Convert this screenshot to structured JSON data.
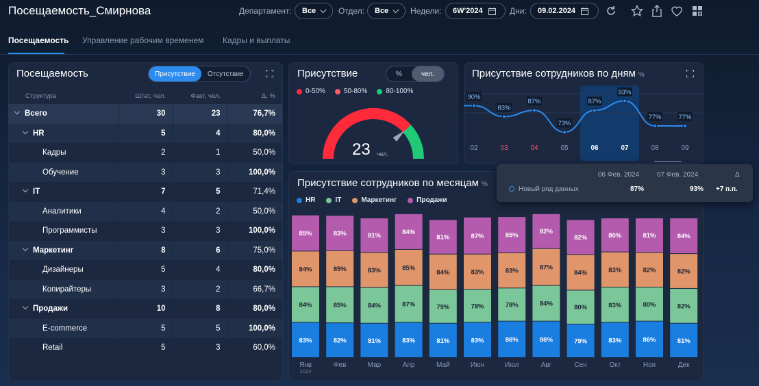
{
  "header": {
    "title": "Посещаемость_Смирнова",
    "filters": {
      "department_label": "Департамент:",
      "department_value": "Все",
      "division_label": "Отдел:",
      "division_value": "Все",
      "weeks_label": "Недели:",
      "weeks_value": "6W'2024",
      "days_label": "Дни:",
      "days_value": "09.02.2024"
    },
    "icons": [
      "refresh-icon",
      "star-icon",
      "share-icon",
      "heart-icon",
      "grid-icon"
    ]
  },
  "tabs": [
    {
      "label": "Посещаемость",
      "active": true
    },
    {
      "label": "Управление рабочим временем",
      "active": false
    },
    {
      "label": "Кадры и выплаты",
      "active": false
    }
  ],
  "attendance_table": {
    "title": "Посещаемость",
    "toggle": {
      "on": "Присутствие",
      "off": "Отсутствие"
    },
    "columns": [
      "Структура",
      "Штат, чел.",
      "Факт, чел.",
      "Δ, %"
    ],
    "rows": [
      {
        "name": "Всего",
        "level": 0,
        "staff": "30",
        "fact": "23",
        "delta": "76,7%",
        "status": "neg"
      },
      {
        "name": "HR",
        "level": 1,
        "staff": "5",
        "fact": "4",
        "delta": "80,0%",
        "status": "pos"
      },
      {
        "name": "Кадры",
        "level": 2,
        "staff": "2",
        "fact": "1",
        "delta": "50,0%",
        "status": "neg"
      },
      {
        "name": "Обучение",
        "level": 2,
        "staff": "3",
        "fact": "3",
        "delta": "100,0%",
        "status": "pos"
      },
      {
        "name": "IT",
        "level": 1,
        "staff": "7",
        "fact": "5",
        "delta": "71,4%",
        "status": "neg"
      },
      {
        "name": "Аналитики",
        "level": 2,
        "staff": "4",
        "fact": "2",
        "delta": "50,0%",
        "status": "neg"
      },
      {
        "name": "Программисты",
        "level": 2,
        "staff": "3",
        "fact": "3",
        "delta": "100,0%",
        "status": "pos"
      },
      {
        "name": "Маркетинг",
        "level": 1,
        "staff": "8",
        "fact": "6",
        "delta": "75,0%",
        "status": "neg"
      },
      {
        "name": "Дизайнеры",
        "level": 2,
        "staff": "5",
        "fact": "4",
        "delta": "80,0%",
        "status": "pos"
      },
      {
        "name": "Копирайтеры",
        "level": 2,
        "staff": "3",
        "fact": "2",
        "delta": "66,7%",
        "status": "neg"
      },
      {
        "name": "Продажи",
        "level": 1,
        "staff": "10",
        "fact": "8",
        "delta": "80,0%",
        "status": "pos"
      },
      {
        "name": "E-commerce",
        "level": 2,
        "staff": "5",
        "fact": "5",
        "delta": "100,0%",
        "status": "pos"
      },
      {
        "name": "Retail",
        "level": 2,
        "staff": "5",
        "fact": "3",
        "delta": "60,0%",
        "status": "neg"
      }
    ]
  },
  "presence_gauge": {
    "title": "Присутствие",
    "toggle": {
      "pct": "%",
      "people": "чел."
    },
    "legend": [
      {
        "label": "0-50%",
        "color": "#ff2a3a"
      },
      {
        "label": "50-80%",
        "color": "#ff5a66"
      },
      {
        "label": "80-100%",
        "color": "#1fc978"
      }
    ],
    "value": "23",
    "unit": "чел.",
    "value_fraction": 0.767
  },
  "chart_data": [
    {
      "type": "line",
      "title": "Присутствие сотрудников по дням",
      "unit": "%",
      "categories": [
        "02",
        "03",
        "04",
        "05",
        "06",
        "07",
        "08",
        "09"
      ],
      "values": [
        90,
        83,
        87,
        73,
        87,
        93,
        77,
        77
      ],
      "weekend": [
        "03",
        "04"
      ],
      "highlight": [
        "06",
        "07"
      ],
      "tooltip": {
        "col1": "06 Фев. 2024",
        "col2": "07 Фев. 2024",
        "col3": "Δ",
        "series": "Новый ряд данных",
        "v1": "87%",
        "v2": "93%",
        "delta": "+7 п.п."
      }
    },
    {
      "type": "bar",
      "stacked": true,
      "title": "Присутствие сотрудников по месяцам",
      "unit": "%",
      "categories": [
        "Янв",
        "Фев",
        "Мар",
        "Апр",
        "Май",
        "Июн",
        "Июл",
        "Авг",
        "Сен",
        "Окт",
        "Ноя",
        "Дек"
      ],
      "year_label": "2024",
      "series": [
        {
          "name": "HR",
          "color": "#1a7de0",
          "values": [
            83,
            82,
            81,
            83,
            81,
            83,
            86,
            86,
            79,
            83,
            86,
            81
          ]
        },
        {
          "name": "IT",
          "color": "#7cc79a",
          "values": [
            84,
            85,
            84,
            87,
            79,
            78,
            78,
            84,
            80,
            83,
            80,
            82
          ]
        },
        {
          "name": "Маркетинг",
          "color": "#e0956a",
          "values": [
            84,
            85,
            83,
            85,
            84,
            83,
            83,
            87,
            84,
            83,
            82,
            82
          ]
        },
        {
          "name": "Продажи",
          "color": "#b45bad",
          "values": [
            85,
            83,
            81,
            84,
            81,
            87,
            85,
            82,
            82,
            80,
            81,
            84
          ]
        }
      ]
    }
  ]
}
